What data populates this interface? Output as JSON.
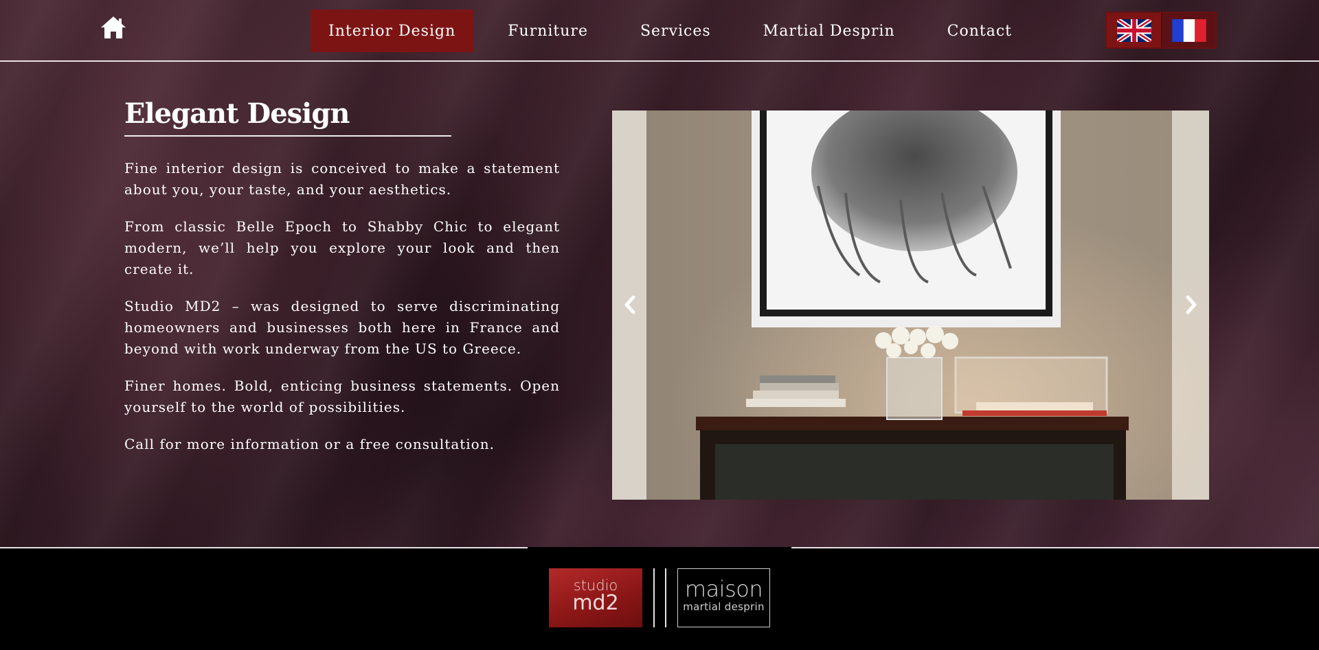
{
  "header": {
    "home_icon": "home-icon",
    "nav": [
      {
        "label": "Interior Design",
        "active": true
      },
      {
        "label": "Furniture",
        "active": false
      },
      {
        "label": "Services",
        "active": false
      },
      {
        "label": "Martial Desprin",
        "active": false
      },
      {
        "label": "Contact",
        "active": false
      }
    ],
    "languages": [
      {
        "icon": "uk-flag-icon",
        "active": true
      },
      {
        "icon": "france-flag-icon",
        "active": false
      }
    ]
  },
  "main": {
    "heading": "Elegant Design",
    "paragraphs": [
      "Fine interior design is conceived to make a statement about you, your taste, and your aesthetics.",
      "From classic Belle Epoch to Shabby Chic to elegant modern, we’ll help you explore your look and then create it.",
      "Studio MD2 – was designed to serve discriminating homeowners and businesses both here in France and beyond with work underway from the US to Greece.",
      "Finer homes. Bold, enticing business statements. Open yourself to the world of possibilities.",
      "Call for more information or a free consultation."
    ],
    "slider": {
      "prev_icon": "chevron-left-icon",
      "next_icon": "chevron-right-icon"
    }
  },
  "footer": {
    "logo_studio": {
      "line1": "studio",
      "line2": "md2"
    },
    "logo_maison": {
      "line1": "maison",
      "line2": "martial desprin"
    }
  },
  "colors": {
    "accent": "#7d1414",
    "background": "#3a1f29",
    "footer": "#000000"
  }
}
